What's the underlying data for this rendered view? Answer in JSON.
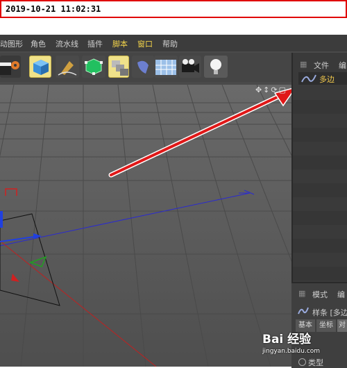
{
  "timestamp": "2019-10-21 11:02:31",
  "menu": {
    "items": [
      "动图形",
      "角色",
      "流水线",
      "插件",
      "脚本",
      "窗口",
      "帮助"
    ]
  },
  "object_manager": {
    "tabs": [
      "文件",
      "编"
    ],
    "object_label": "多边"
  },
  "attributes": {
    "tabs": [
      "模式",
      "编"
    ],
    "object_label": "样条 [多边",
    "sub_tabs": [
      "基本",
      "坐标",
      "对"
    ],
    "field_label": "类型"
  },
  "watermark": {
    "brand": "Bai 经验",
    "url": "jingyan.baidu.com"
  },
  "colors": {
    "accent_yellow": "#f2c94c",
    "arrow_red": "#e01818",
    "timestamp_border": "#e00000"
  }
}
